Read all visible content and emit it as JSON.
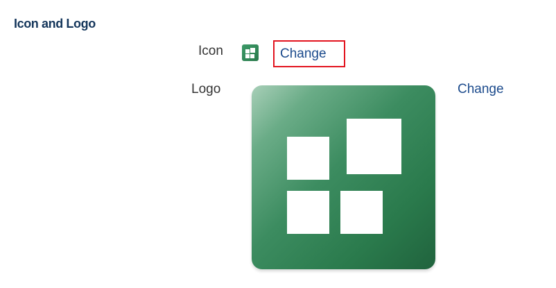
{
  "section": {
    "title": "Icon and Logo"
  },
  "icon_row": {
    "label": "Icon",
    "icon": "tiles-icon",
    "change_label": "Change",
    "change_highlighted": true,
    "highlight_color": "#e2131e"
  },
  "logo_row": {
    "label": "Logo",
    "logo": "tiles-logo",
    "change_label": "Change"
  },
  "colors": {
    "title": "#14365b",
    "link": "#1b4a8c",
    "label": "#333333",
    "logo_green_light": "#a8cfb8",
    "logo_green_dark": "#2a7a4c"
  }
}
